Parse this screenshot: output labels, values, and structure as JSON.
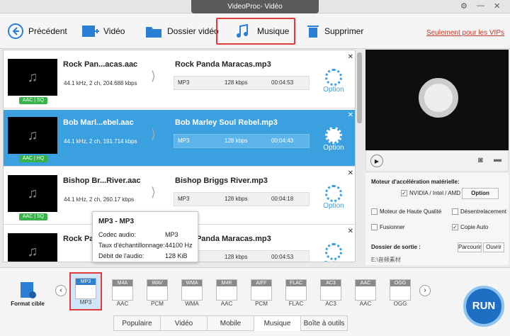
{
  "window": {
    "title": "VideoProc- Vidéo"
  },
  "toolbar": {
    "back": "Précédent",
    "video": "Vidéo",
    "folder": "Dossier vidéo",
    "music": "Musique",
    "delete": "Supprimer",
    "vip_link": "Seulement pour les VIPs"
  },
  "items": [
    {
      "src": "Rock Pan...acas.aac",
      "info": "44.1 kHz, 2 ch, 204.688 kbps",
      "tag": "AAC | SQ",
      "dst": "Rock Panda  Maracas.mp3",
      "fmt": "MP3",
      "kbps": "128 kbps",
      "dur": "00:04:53",
      "option": "Option"
    },
    {
      "src": "Bob Marl...ebel.aac",
      "info": "44.1 kHz, 2 ch, 191.714 kbps",
      "tag": "AAC | HQ",
      "dst": "Bob Marley  Soul Rebel.mp3",
      "fmt": "MP3",
      "kbps": "128 kbps",
      "dur": "00:04:43",
      "option": "Option"
    },
    {
      "src": "Bishop Br...River.aac",
      "info": "44.1 kHz, 2 ch, 260.17 kbps",
      "tag": "AAC | SQ",
      "dst": "Bishop Briggs  River.mp3",
      "fmt": "MP3",
      "kbps": "128 kbps",
      "dur": "00:04:18",
      "option": "Option"
    },
    {
      "src": "Rock Pa",
      "info": "",
      "tag": "",
      "dst": "Rock Panda  Maracas.mp3",
      "fmt": "MP3",
      "kbps": "128 kbps",
      "dur": "00:04:53",
      "option": "Option"
    }
  ],
  "tooltip": {
    "title": "MP3 - MP3",
    "rows": [
      {
        "k": "Codec audio:",
        "v": "MP3"
      },
      {
        "k": "Taux d'échantillonnage:",
        "v": "44100 Hz"
      },
      {
        "k": "Débit de l'audio:",
        "v": "128 KiB"
      }
    ]
  },
  "panel": {
    "hw_title": "Moteur d'accélération matérielle:",
    "hw_chip": "NVIDIA / Intel / AMD",
    "option_btn": "Option",
    "high_quality": "Moteur de Haute Qualité",
    "deinterlace": "Désentrelacement",
    "merge": "Fusionner",
    "autocopy": "Copie Auto",
    "output_label": "Dossier de sortie :",
    "browse": "Parcourir",
    "open": "Ouvrir",
    "output_path": "E:\\音频素材"
  },
  "bottom": {
    "target": "Format cible",
    "run": "RUN",
    "formats": [
      {
        "h": "MP3",
        "l": "MP3"
      },
      {
        "h": "M4A",
        "l": "AAC"
      },
      {
        "h": "WAV",
        "l": "PCM"
      },
      {
        "h": "WMA",
        "l": "WMA"
      },
      {
        "h": "M4R",
        "l": "AAC"
      },
      {
        "h": "AIFF",
        "l": "PCM"
      },
      {
        "h": "FLAC",
        "l": "FLAC"
      },
      {
        "h": "AC3",
        "l": "AC3"
      },
      {
        "h": "AAC",
        "l": "AAC"
      },
      {
        "h": "OGG",
        "l": "OGG"
      }
    ],
    "tabs": [
      "Populaire",
      "Vidéo",
      "Mobile",
      "Musique",
      "Boîte à outils"
    ]
  }
}
